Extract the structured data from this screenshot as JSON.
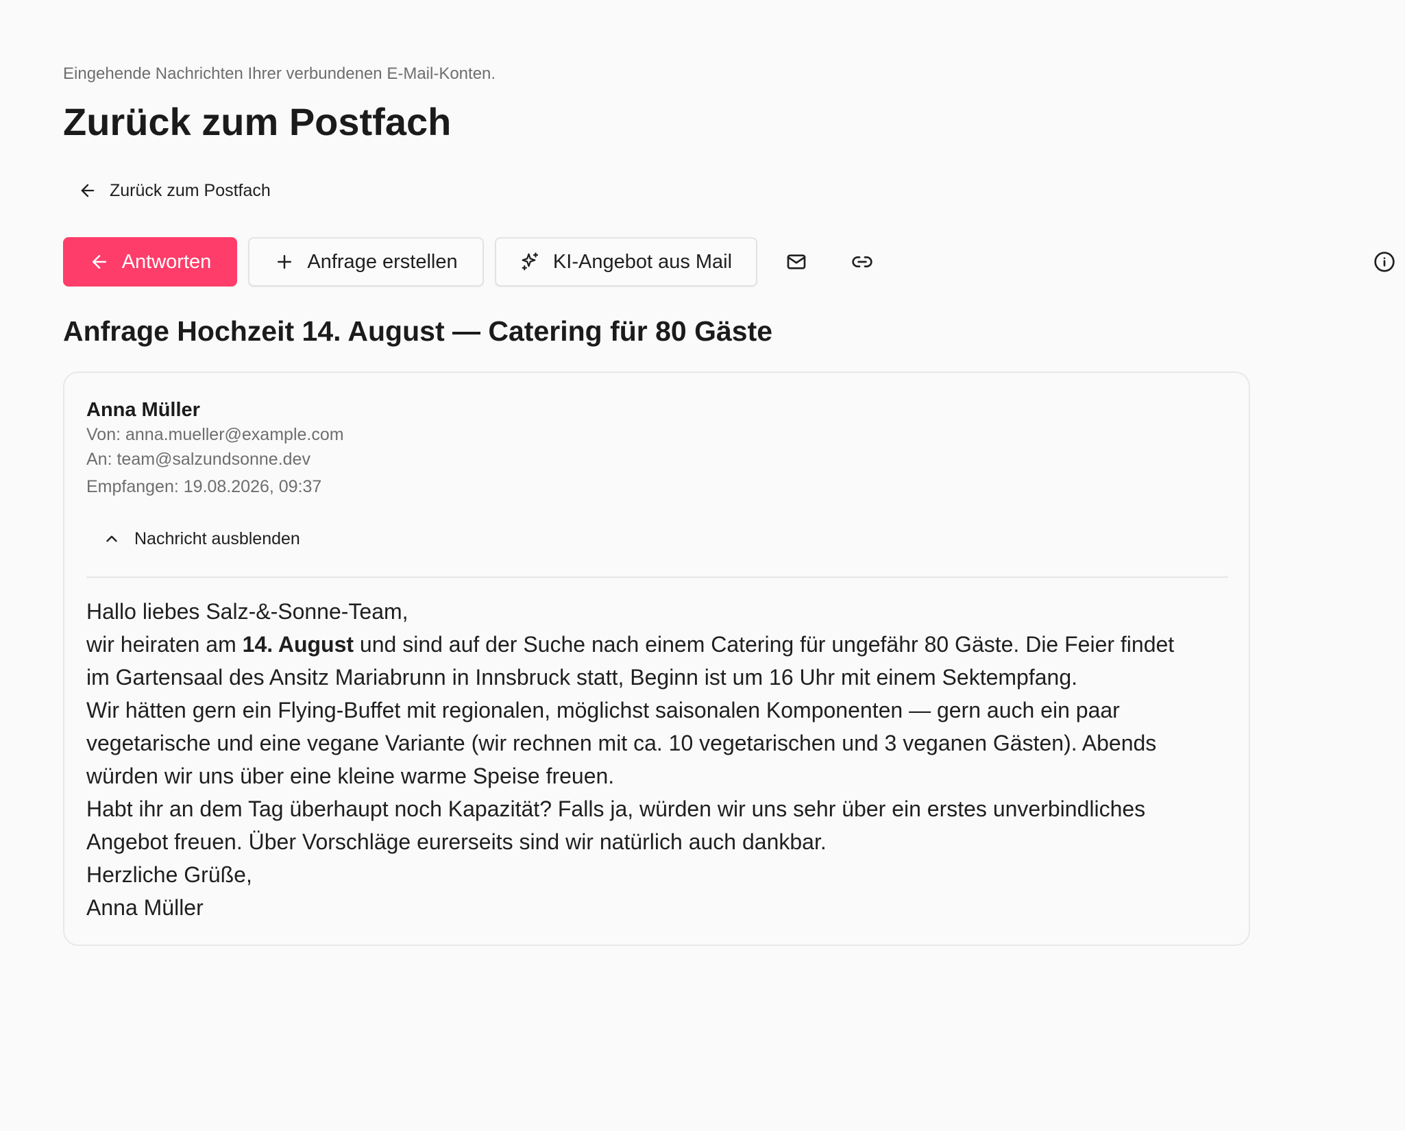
{
  "header": {
    "subtitle": "Eingehende Nachrichten Ihrer verbundenen E-Mail-Konten.",
    "title": "Zurück zum Postfach",
    "back_link_label": "Zurück zum Postfach"
  },
  "toolbar": {
    "reply_label": "Antworten",
    "create_request_label": "Anfrage erstellen",
    "ai_offer_label": "KI-Angebot aus Mail"
  },
  "icons": {
    "back": "arrow-left-icon",
    "reply": "arrow-left-icon",
    "create": "plus-icon",
    "ai": "sparkles-icon",
    "mail": "envelope-icon",
    "link": "link-icon",
    "info": "info-icon",
    "toggle": "chevron-up-icon"
  },
  "colors": {
    "accent": "#ff3d6a",
    "background": "#fafafa",
    "muted_text": "#6e6e6e"
  },
  "mail": {
    "subject": "Anfrage Hochzeit 14. August — Catering für 80 Gäste",
    "sender_name": "Anna Müller",
    "from": "Von: anna.mueller@example.com",
    "to": "An: team@salzundsonne.dev",
    "received": "Empfangen: 19.08.2026, 09:37",
    "toggle_label": "Nachricht ausblenden",
    "body": {
      "greeting": "Hallo liebes Salz-&-Sonne-Team,",
      "line2_pre": "wir heiraten am ",
      "line2_bold": "14. August",
      "line2_post": " und sind auf der Suche nach einem Catering für ungefähr 80 Gäste. Die Feier findet",
      "line3": "im Gartensaal des Ansitz Mariabrunn in Innsbruck statt, Beginn ist um 16 Uhr mit einem Sektempfang.",
      "line4": "Wir hätten gern ein Flying-Buffet mit regionalen, möglichst saisonalen Komponenten — gern auch ein paar",
      "line5": "vegetarische und eine vegane Variante (wir rechnen mit ca. 10 vegetarischen und 3 veganen Gästen). Abends",
      "line6": "würden wir uns über eine kleine warme Speise freuen.",
      "line7": "Habt ihr an dem Tag überhaupt noch Kapazität? Falls ja, würden wir uns sehr über ein erstes unverbindliches",
      "line8": "Angebot freuen. Über Vorschläge eurerseits sind wir natürlich auch dankbar.",
      "closing": "Herzliche Grüße,",
      "signature": "Anna Müller"
    }
  }
}
